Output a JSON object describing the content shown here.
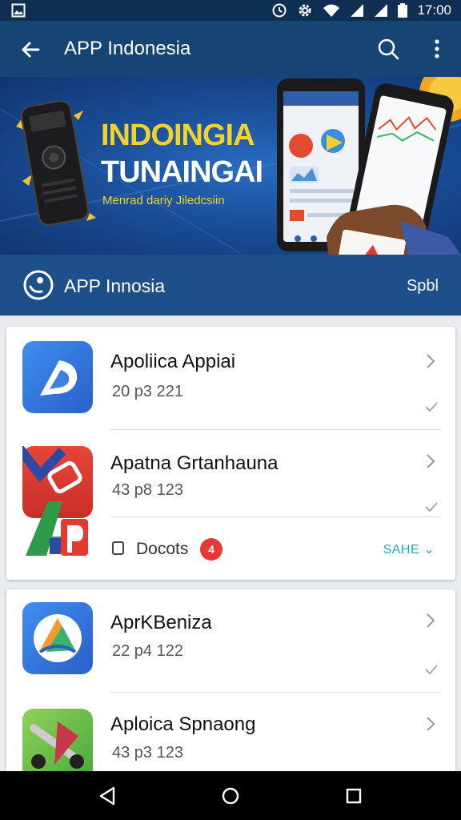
{
  "status_bar": {
    "time": "17:00"
  },
  "toolbar": {
    "title": "APP Indonesia"
  },
  "banner": {
    "headline_1": "INDOINGIA",
    "headline_2": "TUNAINGAI",
    "tagline": "Menrad dariy Jiledcsiin"
  },
  "section": {
    "title": "APP Innosia",
    "action": "Spbl"
  },
  "apps": [
    {
      "name": "Apoliica Appiai",
      "meta": "20 p3 221"
    },
    {
      "name": "Apatna Grtanhauna",
      "meta": "43 p8 123"
    },
    {
      "name": "AprKBeniza",
      "meta": "22 p4 122"
    },
    {
      "name": "Aploica Spnaong",
      "meta": "43 p3 123"
    }
  ],
  "docs": {
    "label": "Docots",
    "badge": "4",
    "share": "SAHE"
  },
  "colors": {
    "toolbar": "#164574",
    "status": "#0f2f52",
    "accent_yellow": "#f4d22e",
    "badge_red": "#e53935",
    "share_teal": "#2aa7b8"
  }
}
